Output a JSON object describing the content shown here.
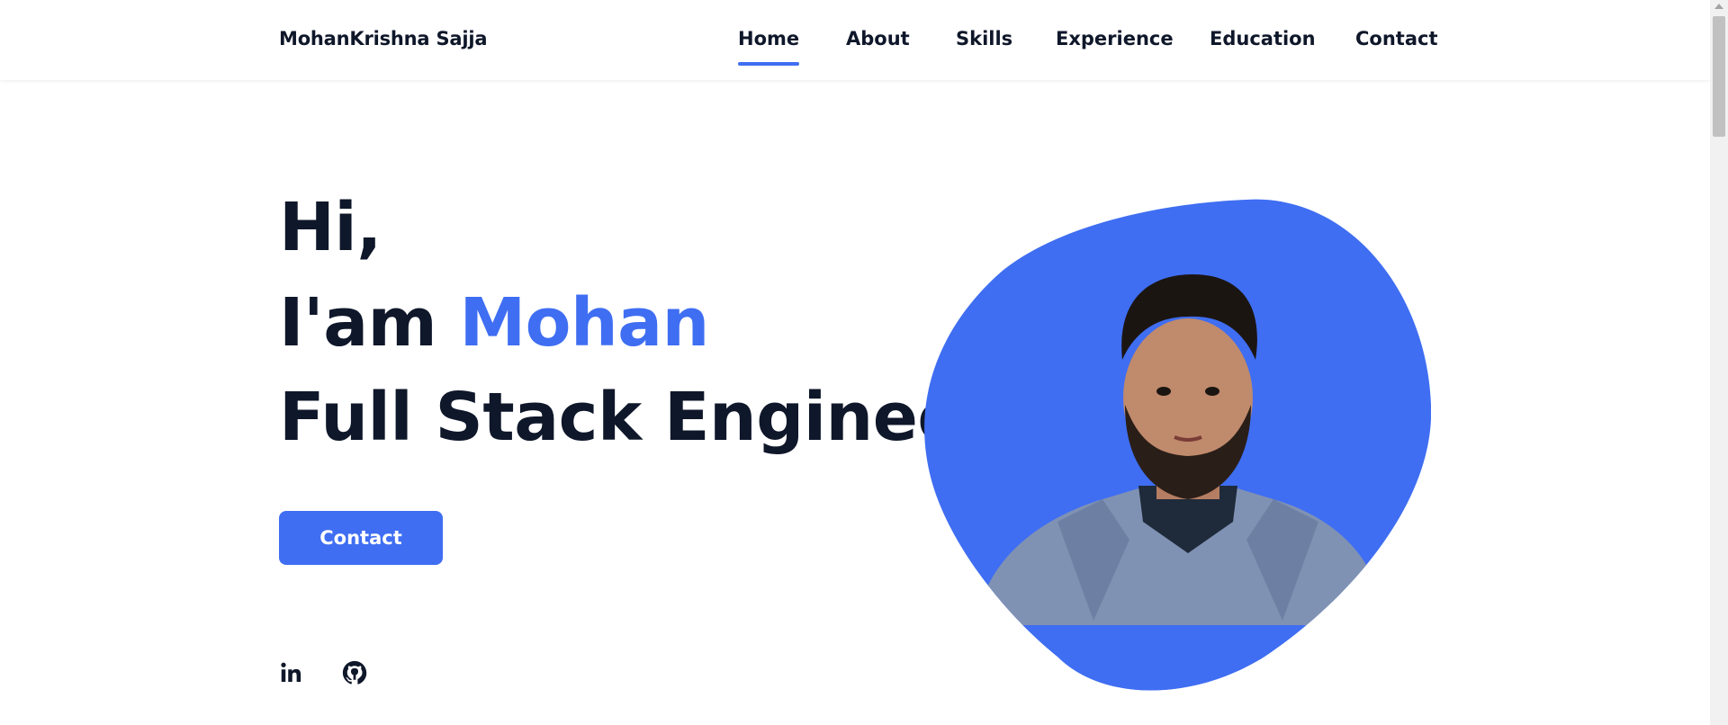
{
  "header": {
    "brand": "MohanKrishna Sajja",
    "nav": [
      {
        "label": "Home",
        "active": true
      },
      {
        "label": "About",
        "active": false
      },
      {
        "label": "Skills",
        "active": false
      },
      {
        "label": "Experience",
        "active": false
      },
      {
        "label": "Education",
        "active": false
      },
      {
        "label": "Contact",
        "active": false
      }
    ]
  },
  "hero": {
    "greeting": "Hi,",
    "intro_prefix": "I'am ",
    "name": "Mohan",
    "role": "Full Stack Engineer",
    "contact_label": "Contact"
  },
  "social": [
    {
      "icon": "linkedin-icon"
    },
    {
      "icon": "github-icon"
    }
  ],
  "colors": {
    "accent": "#3f6ef2",
    "text": "#0f172a"
  }
}
